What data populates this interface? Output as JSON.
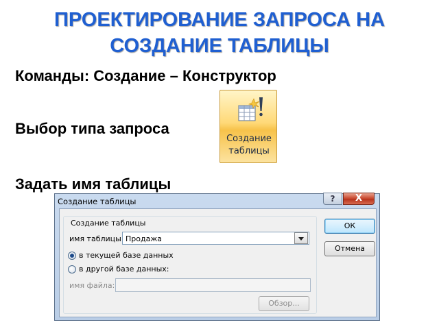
{
  "slide": {
    "title_line1": "ПРОЕКТИРОВАНИЕ ЗАПРОСА НА",
    "title_line2": "СОЗДАНИЕ ТАБЛИЦЫ",
    "commands_line": "Команды: Создание – Конструктор",
    "query_type_line": "Выбор типа запроса",
    "table_name_line": "Задать имя таблицы",
    "title_color": "#1f5fd1"
  },
  "ribbon_button": {
    "label_line1": "Создание",
    "label_line2": "таблицы",
    "icon": "make-table-icon"
  },
  "dialog": {
    "title": "Создание таблицы",
    "help_label": "?",
    "close_label": "X",
    "group_label": "Создание таблицы",
    "table_name_label": "имя таблицы:",
    "table_name_value": "Продажа",
    "radio_current_db": "в текущей базе данных",
    "radio_other_db": "в другой базе данных:",
    "file_name_label": "имя файла:",
    "file_name_value": "",
    "browse_label": "Обзор...",
    "ok_label": "ОК",
    "cancel_label": "Отмена",
    "selected_option": "current_db"
  }
}
